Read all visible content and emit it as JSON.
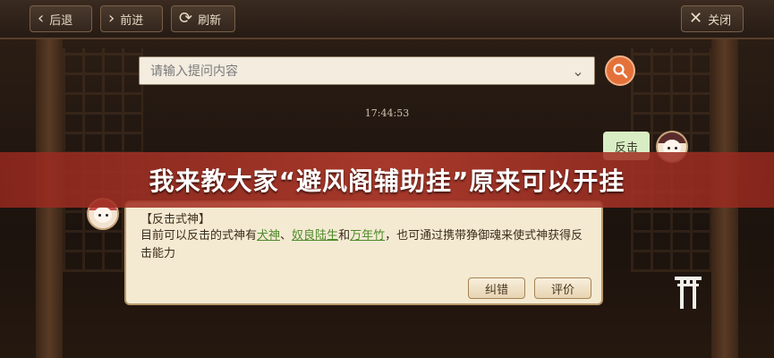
{
  "toolbar": {
    "back_label": "后退",
    "forward_label": "前进",
    "refresh_label": "刷新",
    "close_label": "关闭"
  },
  "search": {
    "placeholder": "请输入提问内容"
  },
  "chat": {
    "time": "17:44:53",
    "user_message": "反击",
    "answer": {
      "title": "【反击式神】",
      "text_prefix": "目前可以反击的式神有",
      "link1": "犬神",
      "sep1": "、",
      "link2": "奴良陆生",
      "sep2": "和",
      "link3": "万年竹",
      "text_suffix": "，也可通过携带狰御魂来使式神获得反击能力",
      "report_label": "纠错",
      "rate_label": "评价"
    }
  },
  "banner": {
    "text": "我来教大家“避风阁辅助挂”原来可以开挂"
  },
  "colors": {
    "accent": "#e4713a",
    "link": "#4e8a2a",
    "banner": "#b43c2d"
  }
}
